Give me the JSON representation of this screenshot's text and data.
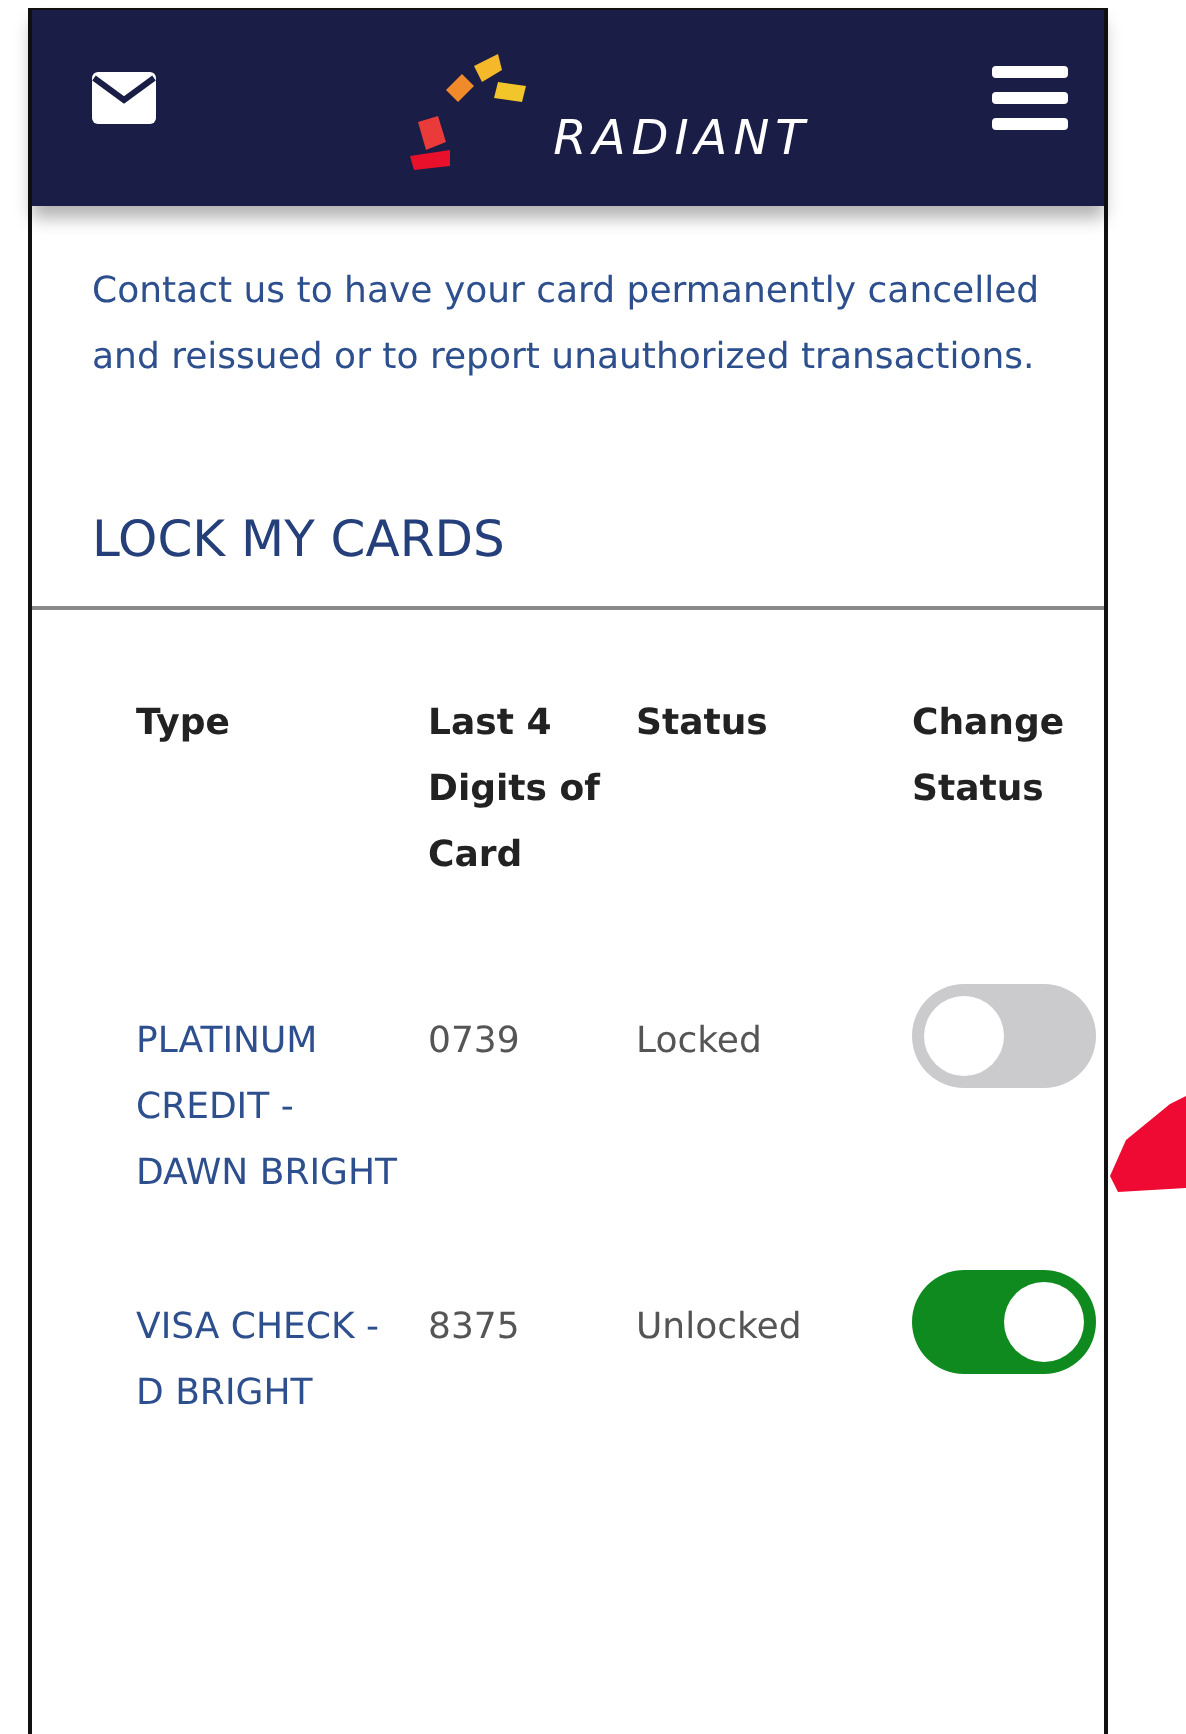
{
  "header": {
    "brand": "RADIANT"
  },
  "intro": "Contact us to have your card permanently cancelled and reissued or to report unauthorized transactions.",
  "section_title": "LOCK MY CARDS",
  "table": {
    "columns": [
      "Type",
      "Last 4 Digits of Card",
      "Status",
      "Change Status"
    ],
    "rows": [
      {
        "type": "PLATINUM CREDIT - DAWN BRIGHT",
        "last4": "0739",
        "status": "Locked",
        "on": false
      },
      {
        "type": "VISA CHECK - D BRIGHT",
        "last4": "8375",
        "status": "Unlocked",
        "on": true
      }
    ]
  }
}
